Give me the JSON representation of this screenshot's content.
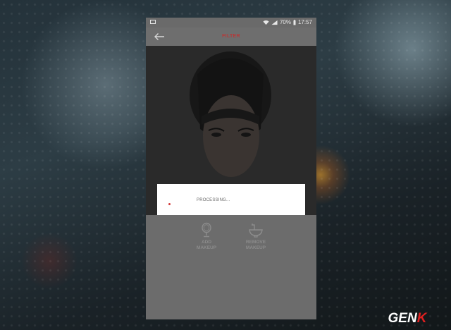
{
  "status_bar": {
    "battery": "70%",
    "time": "17:57"
  },
  "app_bar": {
    "title": "FILTER"
  },
  "dialog": {
    "message": "PROCESSING..."
  },
  "tools": [
    {
      "label": "ADD\nMAKEUP",
      "icon": "mirror-icon"
    },
    {
      "label": "REMOVE\nMAKEUP",
      "icon": "sink-icon"
    }
  ],
  "watermark": {
    "text": "GENK"
  },
  "colors": {
    "accent": "#b43a3a",
    "spinner": "#d23a3a",
    "overlay": "#6e6e6e"
  }
}
